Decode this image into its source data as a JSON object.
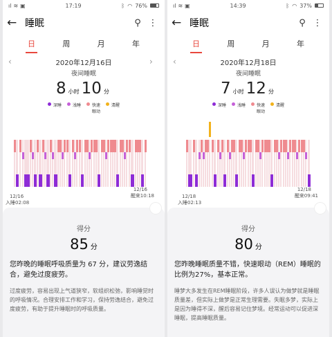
{
  "colors": {
    "deep": "#8e2cd6",
    "light": "#c560d8",
    "rem": "#ef8a8f",
    "awake": "#f2b21b",
    "accent": "#e8473d"
  },
  "legend": [
    {
      "label": "深睡",
      "color": "#8e2cd6"
    },
    {
      "label": "浅睡",
      "color": "#c560d8"
    },
    {
      "label": "快速眼动",
      "color": "#ef8a8f"
    },
    {
      "label": "清醒",
      "color": "#f2b21b"
    }
  ],
  "screens": [
    {
      "status": {
        "time": "17:19",
        "battery": "76%",
        "battery_level": 0.76
      },
      "title": "睡眠",
      "tabs": [
        "日",
        "周",
        "月",
        "年"
      ],
      "date": "2020年12月16日",
      "subtitle": "夜间睡眠",
      "hours": "8",
      "hours_unit": "小时",
      "minutes": "10",
      "minutes_unit": "分",
      "start_date": "12/16",
      "start_text": "入睡02:08",
      "end_date": "12/16",
      "end_text": "醒来10:18",
      "score_label": "得分",
      "score": "85",
      "score_unit": "分",
      "desc1": "您昨晚的睡眠呼吸质量为 67 分，建议劳逸结合，避免过度疲劳。",
      "desc2": "过度疲劳，容易出现上气道狭窄，软组织松弛，影响睡觉时的呼吸情况。合理安排工作和学习，保持劳逸结合，避免过度疲劳，有助于提升睡眠时的呼吸质量。"
    },
    {
      "status": {
        "time": "14:39",
        "battery": "37%",
        "battery_level": 0.37
      },
      "title": "睡眠",
      "tabs": [
        "日",
        "周",
        "月",
        "年"
      ],
      "date": "2020年12月18日",
      "subtitle": "夜间睡眠",
      "hours": "7",
      "hours_unit": "小时",
      "minutes": "12",
      "minutes_unit": "分",
      "start_date": "12/18",
      "start_text": "入睡02:13",
      "end_date": "12/18",
      "end_text": "醒来09:41",
      "score_label": "得分",
      "score": "80",
      "score_unit": "分",
      "desc1": "您昨晚睡眠质量不错，快速眼动（REM）睡眠的比例为27%，基本正常。",
      "desc2": "睡梦大多发生在REM睡眠阶段，许多人误认为做梦就是睡眠质量差，但实际上做梦是正常生理需要。失眠多梦，实际上是因为睡得不深，醒后容易记住梦境。经常运动可以促进深睡眠，提高睡眠质量。"
    }
  ]
}
